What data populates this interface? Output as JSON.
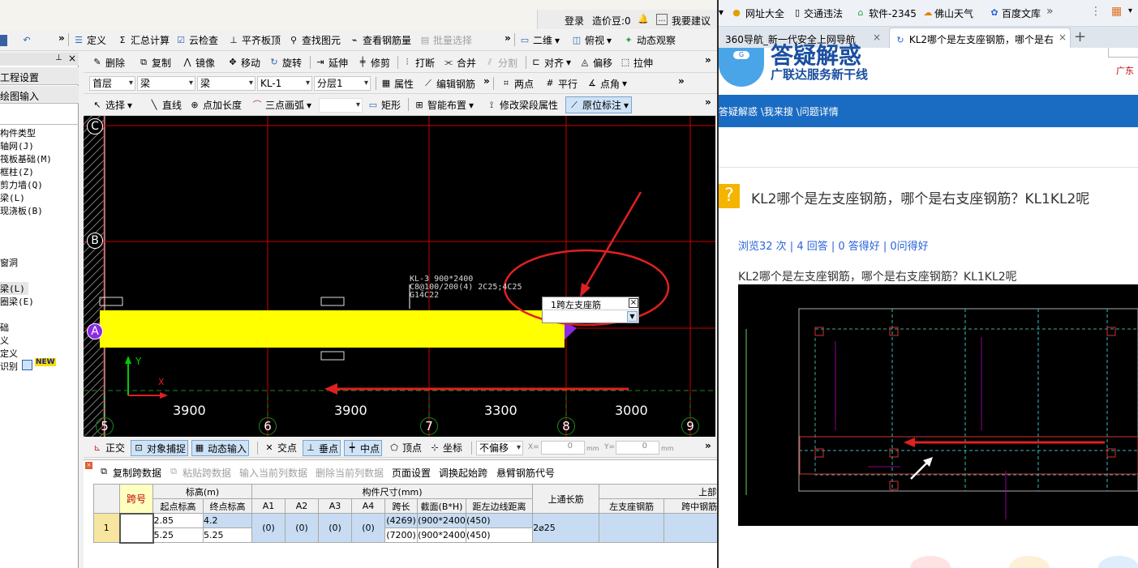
{
  "topbar": {
    "login": "登录",
    "price": "造价豆:0",
    "suggest": "我要建议"
  },
  "toolbar1": {
    "define": "定义",
    "sum": "汇总计算",
    "cloud": "云检查",
    "flat": "平齐板顶",
    "find": "查找图元",
    "view_rebar": "查看钢筋量",
    "batch": "批量选择",
    "view2d": "二维",
    "top_view": "俯视",
    "dynamic": "动态观察"
  },
  "toolbar2": {
    "delete": "删除",
    "copy": "复制",
    "mirror": "镜像",
    "move": "移动",
    "rotate": "旋转",
    "extend": "延伸",
    "trim": "修剪",
    "break": "打断",
    "merge": "合并",
    "split": "分割",
    "align": "对齐",
    "offset": "偏移",
    "stretch": "拉伸"
  },
  "toolbar3": {
    "floor": "首层",
    "type1": "梁",
    "type2": "梁",
    "name": "KL-1",
    "layer": "分层1",
    "property": "属性",
    "edit_rebar": "编辑钢筋",
    "two_point": "两点",
    "parallel": "平行",
    "point_angle": "点角"
  },
  "toolbar4": {
    "select": "选择",
    "line": "直线",
    "point_len": "点加长度",
    "arc": "三点画弧",
    "rect": "矩形",
    "smart": "智能布置",
    "modify_span": "修改梁段属性",
    "origin_mark": "原位标注"
  },
  "left_panel": {
    "tab_settings": "工程设置",
    "tab_draw": "绘图输入",
    "tree": [
      "构件类型",
      "轴网(J)",
      "筏板基础(M)",
      "框柱(Z)",
      "剪力墙(Q)",
      "梁(L)",
      "现浇板(B)",
      "",
      "",
      "",
      "",
      "窗洞",
      "",
      "",
      "梁(L)",
      "圈梁(E)",
      "",
      "",
      "础",
      "义",
      "定义",
      "识别"
    ],
    "new_badge": "NEW"
  },
  "canvas": {
    "axis_rows": [
      "C",
      "B",
      "A"
    ],
    "axis_cols": [
      "5",
      "6",
      "7",
      "8",
      "9"
    ],
    "dims": [
      "3900",
      "3900",
      "3300",
      "3000"
    ],
    "beam_label": [
      "KL-3 900*2400",
      "C8@100/200(4) 2C25;4C25",
      "G14C22"
    ],
    "popup_title": "1跨左支座筋",
    "popup_close": "×",
    "y_label": "Y",
    "x_label": "X"
  },
  "statusbar": {
    "ortho": "正交",
    "snap": "对象捕捉",
    "dyn_input": "动态输入",
    "intersect": "交点",
    "perp": "垂点",
    "mid": "中点",
    "vertex": "顶点",
    "coord": "坐标",
    "offset_mode": "不偏移",
    "x_label": "X=",
    "x_val": "0",
    "y_label": "Y=",
    "y_val": "0",
    "unit": "mm"
  },
  "bottom_toolbar": {
    "copy_span": "复制跨数据",
    "paste_span": "粘贴跨数据",
    "input_col": "输入当前列数据",
    "delete_col": "删除当前列数据",
    "page_setup": "页面设置",
    "swap_start": "调换起始跨",
    "cantilever": "悬臂钢筋代号"
  },
  "table": {
    "h_span": "跨号",
    "h_elev": "标高(m)",
    "h_size": "构件尺寸(mm)",
    "h_top_long": "上通长筋",
    "h_top": "上部钢筋",
    "h2": [
      "起点标高",
      "终点标高",
      "A1",
      "A2",
      "A3",
      "A4",
      "跨长",
      "截面(B*H)",
      "距左边线距离",
      "左支座钢筋",
      "跨中钢筋"
    ],
    "rows": [
      {
        "span": "1",
        "start": "2.85",
        "end": "4.2",
        "a1": "(0)",
        "a2": "(0)",
        "a3": "(0)",
        "a4": "(0)",
        "len": "(4269)",
        "sec": "(900*2400",
        "dist": "(450)",
        "top_long": "2⌀25"
      },
      {
        "span": "",
        "start": "5.25",
        "end": "5.25",
        "a1": "",
        "a2": "",
        "a3": "",
        "a4": "",
        "len": "(7200)",
        "sec": "(900*2400",
        "dist": "(450)",
        "top_long": ""
      }
    ]
  },
  "browser": {
    "bookmarks": [
      "网址大全",
      "交通违法",
      "软件-2345",
      "佛山天气",
      "百度文库"
    ],
    "tabs": [
      "360导航_新一代安全上网导航",
      "KL2哪个是左支座钢筋，哪个是右"
    ],
    "logo_text": "答疑解惑",
    "logo_sub": "广联达服务新干线",
    "logo_right": "广东",
    "nav": "答疑解惑 \\我来搜 \\问题详情",
    "question_title": "KL2哪个是左支座钢筋，哪个是右支座钢筋？KL1KL2呢",
    "stats": "浏览32 次 | 4 回答 | 0 答得好 | 0问得好",
    "question_body": "KL2哪个是左支座钢筋，哪个是右支座钢筋？KL1KL2呢"
  },
  "colors": {
    "canvas_bg": "#000000",
    "beam": "#ffff00",
    "grid": "#cc0000",
    "axis": "#00cc00",
    "annot": "#e02020",
    "nav_bg": "#1a6bc2"
  }
}
